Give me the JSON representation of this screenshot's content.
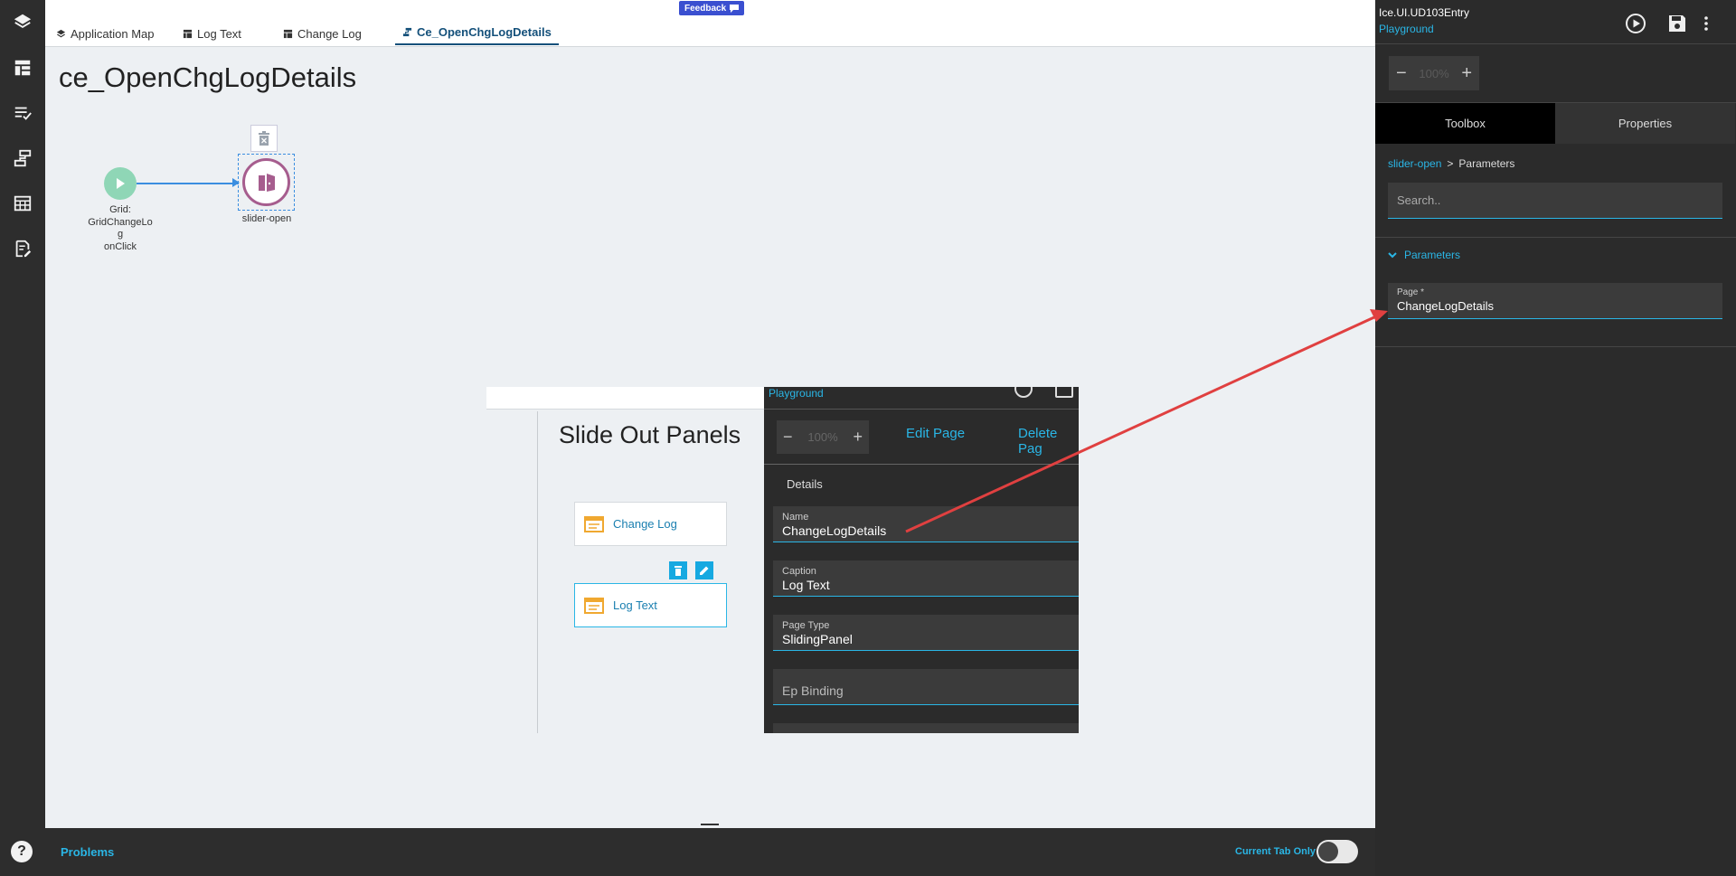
{
  "tabs": [
    {
      "label": "Application Map"
    },
    {
      "label": "Log Text"
    },
    {
      "label": "Change Log"
    },
    {
      "label": "Ce_OpenChgLogDetails"
    }
  ],
  "feedback_label": "Feedback",
  "canvas": {
    "title": "ce_OpenChgLogDetails",
    "start_node": {
      "line1": "Grid:",
      "line2": "GridChangeLo",
      "line3": "g",
      "line4": "onClick"
    },
    "action_node": {
      "label": "slider-open"
    }
  },
  "embedded": {
    "env_label": "Playground",
    "title": "Slide Out Panels",
    "cards": [
      {
        "label": "Change Log"
      },
      {
        "label": "Log Text"
      }
    ],
    "zoom_value": "100%",
    "edit_page_label": "Edit Page",
    "delete_page_label": "Delete Pag",
    "details_heading": "Details",
    "fields": [
      {
        "label": "Name",
        "value": "ChangeLogDetails"
      },
      {
        "label": "Caption",
        "value": "Log Text"
      },
      {
        "label": "Page Type",
        "value": "SlidingPanel"
      }
    ],
    "ep_binding_placeholder": "Ep Binding"
  },
  "problems": {
    "label": "Problems",
    "current_tab_only_label": "Current Tab Only",
    "toggle_on": false
  },
  "right_panel": {
    "app_name": "Ice.UI.UD103Entry",
    "env_label": "Playground",
    "zoom_value": "100%",
    "tabs": [
      {
        "label": "Toolbox",
        "active": true
      },
      {
        "label": "Properties",
        "active": false
      }
    ],
    "breadcrumb": {
      "link": "slider-open",
      "separator": ">",
      "current": "Parameters"
    },
    "search_placeholder": "Search..",
    "section_label": "Parameters",
    "field": {
      "label": "Page *",
      "value": "ChangeLogDetails"
    }
  },
  "colors": {
    "accent": "#2ab6e6",
    "dark_bg": "#2b2b2b",
    "canvas_bg": "#edf0f3",
    "start_node": "#8fd6b6",
    "action_node_border": "#a65d8e",
    "annotation_arrow": "#e04040",
    "feedback": "#3a4fd0"
  },
  "icons": {
    "rail": [
      "layers-icon",
      "layout-icon",
      "list-check-icon",
      "flow-icon",
      "table-icon",
      "doc-edit-icon"
    ],
    "help": "help-icon"
  }
}
